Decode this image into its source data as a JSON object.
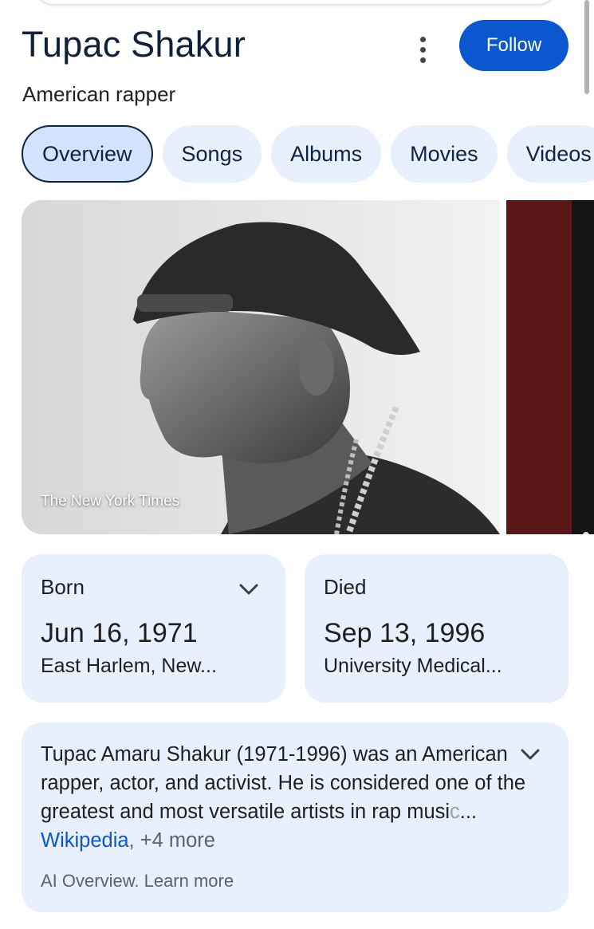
{
  "header": {
    "title": "Tupac Shakur",
    "subtitle": "American rapper",
    "follow_label": "Follow",
    "more_icon": "more-vert-icon"
  },
  "tabs": [
    {
      "label": "Overview",
      "active": true
    },
    {
      "label": "Songs"
    },
    {
      "label": "Albums"
    },
    {
      "label": "Movies"
    },
    {
      "label": "Videos"
    }
  ],
  "images": {
    "main_credit": "The New York Times"
  },
  "facts": {
    "born": {
      "label": "Born",
      "date": "Jun 16, 1971",
      "place": "East Harlem, New..."
    },
    "died": {
      "label": "Died",
      "date": "Sep 13, 1996",
      "place": "University Medical..."
    }
  },
  "summary": {
    "text": "Tupac Amaru Shakur (1971-1996) was an American rapper, actor, and activist. He is considered one of the greatest and most versatile artists in rap musi",
    "faded_tail": "c",
    "ellipsis": "...",
    "source_link": "Wikipedia",
    "more_sources": "+4 more",
    "footer": "AI Overview. Learn more"
  },
  "colors": {
    "accent": "#0b57d0",
    "card_bg": "#e8effd",
    "title": "#10203a"
  }
}
